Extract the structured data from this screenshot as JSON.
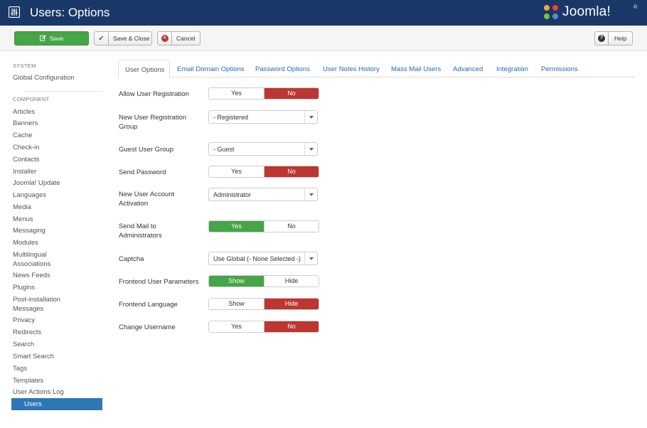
{
  "header": {
    "title": "Users: Options",
    "brand": "Joomla!",
    "brand_mark": "®"
  },
  "toolbar": {
    "save_label": "Save",
    "save_close_label": "Save & Close",
    "cancel_label": "Cancel",
    "help_label": "Help"
  },
  "sidebar": {
    "system_header": "SYSTEM",
    "global_config": "Global Configuration",
    "component_header": "COMPONENT",
    "items": [
      "Articles",
      "Banners",
      "Cache",
      "Check-in",
      "Contacts",
      "Installer",
      "Joomla! Update",
      "Languages",
      "Media",
      "Menus",
      "Messaging",
      "Modules",
      "Multilingual Associations",
      "News Feeds",
      "Plugins",
      "Post-installation Messages",
      "Privacy",
      "Redirects",
      "Search",
      "Smart Search",
      "Tags",
      "Templates",
      "User Actions Log"
    ],
    "active_item": "Users"
  },
  "tabs": [
    "User Options",
    "Email Domain Options",
    "Password Options",
    "User Notes History",
    "Mass Mail Users",
    "Advanced",
    "Integration",
    "Permissions"
  ],
  "form": {
    "allow_registration": {
      "label": "Allow User Registration",
      "options": [
        "Yes",
        "No"
      ],
      "selected": "No"
    },
    "new_user_group": {
      "label": "New User Registration Group",
      "value": "- Registered"
    },
    "guest_group": {
      "label": "Guest User Group",
      "value": "- Guest"
    },
    "send_password": {
      "label": "Send Password",
      "options": [
        "Yes",
        "No"
      ],
      "selected": "No"
    },
    "account_activation": {
      "label": "New User Account Activation",
      "value": "Administrator"
    },
    "mail_admins": {
      "label": "Send Mail to Administrators",
      "options": [
        "Yes",
        "No"
      ],
      "selected": "Yes"
    },
    "captcha": {
      "label": "Captcha",
      "value": "Use Global (- None Selected -)"
    },
    "frontend_params": {
      "label": "Frontend User Parameters",
      "options": [
        "Show",
        "Hide"
      ],
      "selected": "Show"
    },
    "frontend_language": {
      "label": "Frontend Language",
      "options": [
        "Show",
        "Hide"
      ],
      "selected": "Hide"
    },
    "change_username": {
      "label": "Change Username",
      "options": [
        "Yes",
        "No"
      ],
      "selected": "No"
    }
  },
  "colors": {
    "header_bg": "#1a3867",
    "success": "#46a546",
    "danger": "#bd362f",
    "link": "#2a69b8",
    "active_sidebar": "#2f76b4"
  }
}
